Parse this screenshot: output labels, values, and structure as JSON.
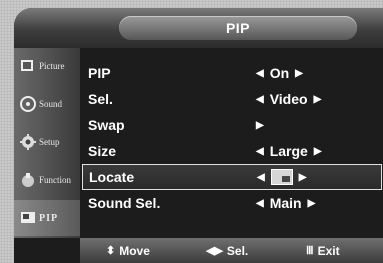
{
  "header": {
    "title": "PIP"
  },
  "sidebar": {
    "items": [
      {
        "label": "Picture",
        "icon": "picture-icon"
      },
      {
        "label": "Sound",
        "icon": "sound-icon"
      },
      {
        "label": "Setup",
        "icon": "setup-icon"
      },
      {
        "label": "Function",
        "icon": "function-icon"
      },
      {
        "label": "PIP",
        "icon": "pip-icon",
        "active": true
      }
    ]
  },
  "menu": {
    "rows": [
      {
        "label": "PIP",
        "value": "On"
      },
      {
        "label": "Sel.",
        "value": "Video"
      },
      {
        "label": "Swap",
        "value": ""
      },
      {
        "label": "Size",
        "value": "Large"
      },
      {
        "label": "Locate",
        "value": "",
        "selected": true
      },
      {
        "label": "Sound Sel.",
        "value": "Main"
      }
    ]
  },
  "footer": {
    "move": "Move",
    "sel": "Sel.",
    "exit": "Exit"
  }
}
